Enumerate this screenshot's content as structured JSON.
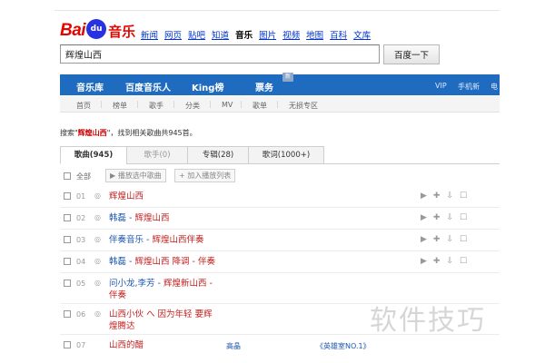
{
  "logo": {
    "bai": "Bai",
    "du": "du",
    "music": "音乐"
  },
  "topnav": [
    "新闻",
    "网页",
    "贴吧",
    "知道",
    "音乐",
    "图片",
    "视频",
    "地图",
    "百科",
    "文库"
  ],
  "search": {
    "value": "辉煌山西",
    "button": "百度一下"
  },
  "bluebar": {
    "items": [
      "音乐库",
      "百度音乐人",
      "King榜",
      "票务"
    ],
    "badge": "新",
    "right": [
      "VIP",
      "手机新",
      "电"
    ]
  },
  "subnav": [
    "首页",
    "榜单",
    "歌手",
    "分类",
    "MV",
    "歌单",
    "无损专区"
  ],
  "summary": {
    "prefix": "搜索\"",
    "keyword": "辉煌山西",
    "suffix": "\"，找到相关歌曲共945首。"
  },
  "tabs": [
    "歌曲(945)",
    "歌手(0)",
    "专辑(28)",
    "歌词(1000+)"
  ],
  "toolbar": {
    "all": "全部",
    "play_selected": "播放选中歌曲",
    "add_to_list": "加入播放列表"
  },
  "songs": [
    {
      "num": "01",
      "title": "辉煌山西",
      "artist": "",
      "album": ""
    },
    {
      "num": "02",
      "title": "辉煌山西",
      "artist": "韩磊 - ",
      "album": ""
    },
    {
      "num": "03",
      "title": "辉煌山西伴奏",
      "artist": "伴奏音乐 - ",
      "album": ""
    },
    {
      "num": "04",
      "title": "辉煌山西 降调 - 伴奏",
      "artist": "韩磊 - ",
      "album": ""
    },
    {
      "num": "05",
      "title": "辉煌新山西 - 伴奏",
      "artist": "问小龙,李芳 - ",
      "album": ""
    },
    {
      "num": "06",
      "title": "山西小伙 へ 因为年轻 要辉煌腾达",
      "artist": "",
      "album": ""
    },
    {
      "num": "07",
      "title": "山西的醋",
      "artist": "",
      "singer": "高晶",
      "album": "《英雄室NO.1》"
    }
  ],
  "watermark": "软件技巧"
}
